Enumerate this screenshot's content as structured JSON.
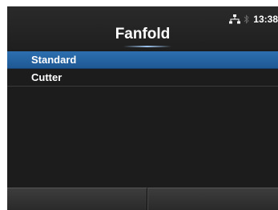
{
  "header": {
    "title": "Fanfold",
    "time": "13:38",
    "network_icon": "network-icon",
    "bluetooth_icon": "bluetooth-icon"
  },
  "menu": {
    "items": [
      {
        "label": "Standard",
        "selected": true
      },
      {
        "label": "Cutter",
        "selected": false
      }
    ]
  },
  "colors": {
    "selection": "#2a66a8",
    "background": "#1c1c1c",
    "text": "#ffffff"
  },
  "footer": {
    "softkeys": [
      "",
      ""
    ]
  }
}
